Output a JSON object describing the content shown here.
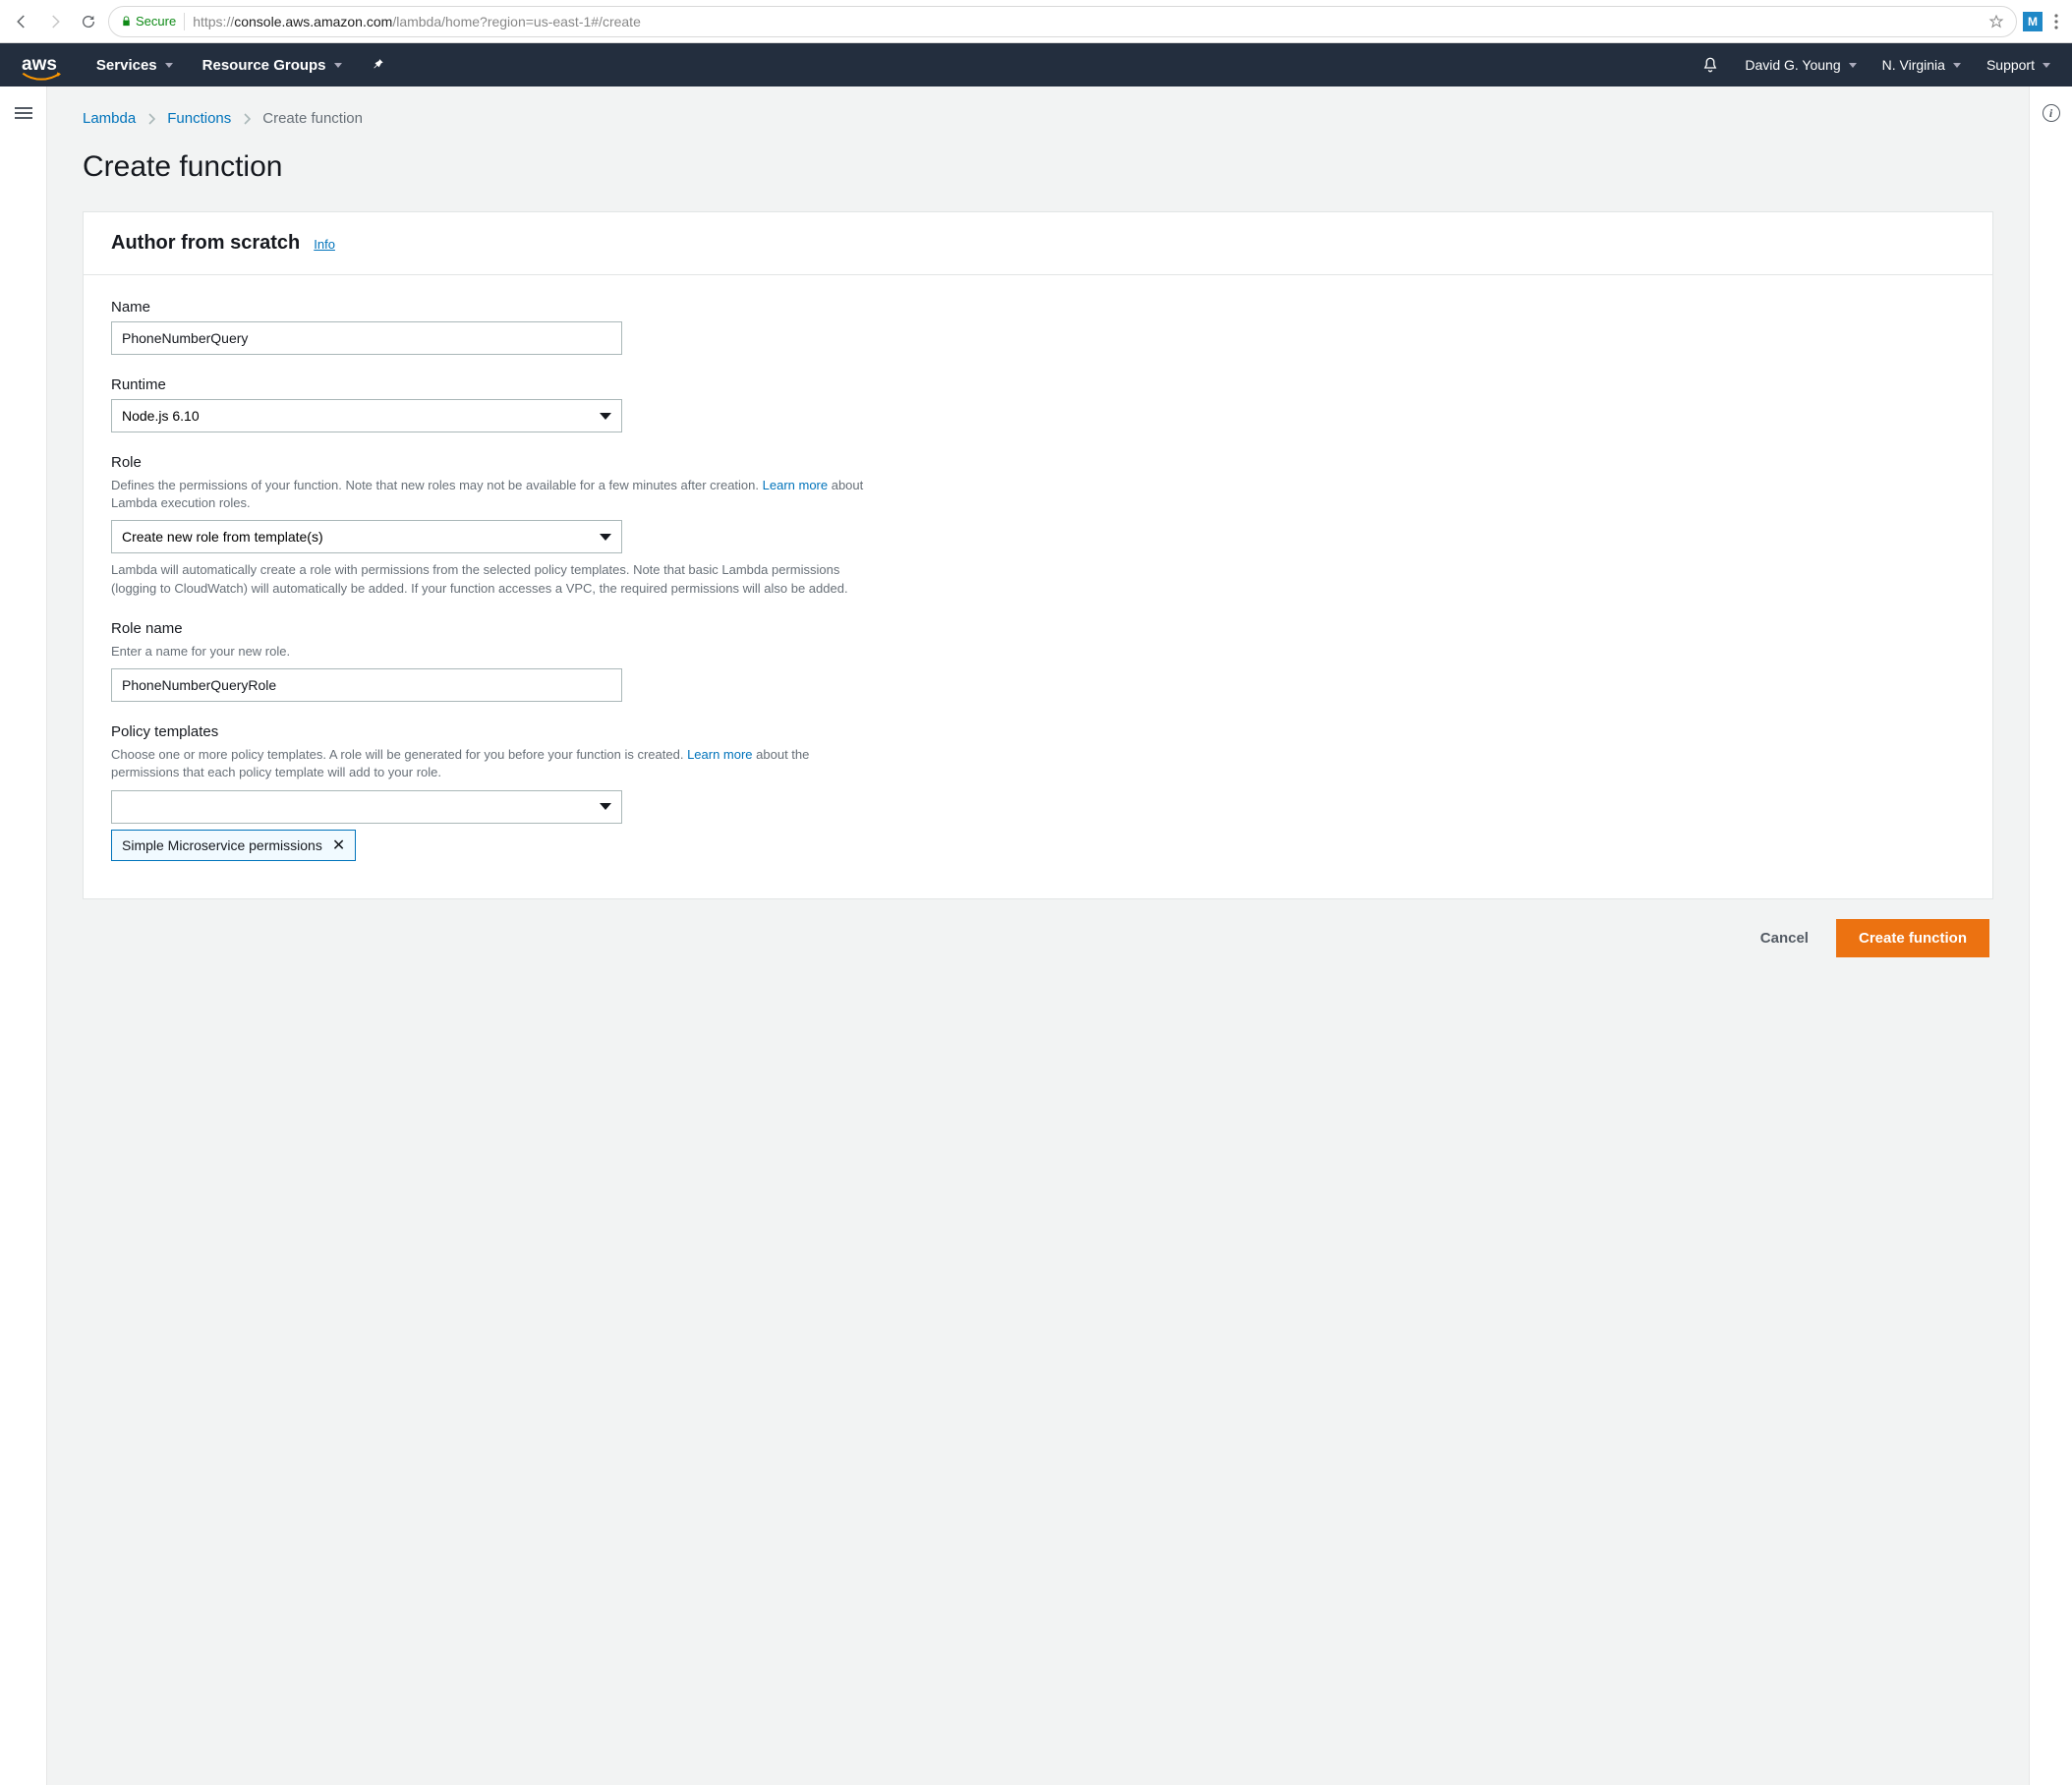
{
  "browser": {
    "secure_label": "Secure",
    "url_scheme": "https://",
    "url_host": "console.aws.amazon.com",
    "url_path": "/lambda/home?region=us-east-1#/create",
    "ext_badge": "M"
  },
  "topnav": {
    "logo": "aws",
    "services": "Services",
    "resource_groups": "Resource Groups",
    "user": "David G. Young",
    "region": "N. Virginia",
    "support": "Support"
  },
  "breadcrumb": {
    "lambda": "Lambda",
    "functions": "Functions",
    "current": "Create function"
  },
  "page": {
    "title": "Create function"
  },
  "panel": {
    "title": "Author from scratch",
    "info": "Info"
  },
  "form": {
    "name_label": "Name",
    "name_value": "PhoneNumberQuery",
    "runtime_label": "Runtime",
    "runtime_value": "Node.js 6.10",
    "role_label": "Role",
    "role_desc_pre": "Defines the permissions of your function. Note that new roles may not be available for a few minutes after creation. ",
    "role_learn_more": "Learn more",
    "role_desc_post": " about Lambda execution roles.",
    "role_value": "Create new role from template(s)",
    "role_after": "Lambda will automatically create a role with permissions from the selected policy templates. Note that basic Lambda permissions (logging to CloudWatch) will automatically be added. If your function accesses a VPC, the required permissions will also be added.",
    "role_name_label": "Role name",
    "role_name_desc": "Enter a name for your new role.",
    "role_name_value": "PhoneNumberQueryRole",
    "policy_label": "Policy templates",
    "policy_desc_pre": "Choose one or more policy templates. A role will be generated for you before your function is created. ",
    "policy_learn_more": "Learn more",
    "policy_desc_post": " about the permissions that each policy template will add to your role.",
    "policy_select_value": "",
    "policy_tag": "Simple Microservice permissions"
  },
  "footer": {
    "cancel": "Cancel",
    "create": "Create function"
  }
}
